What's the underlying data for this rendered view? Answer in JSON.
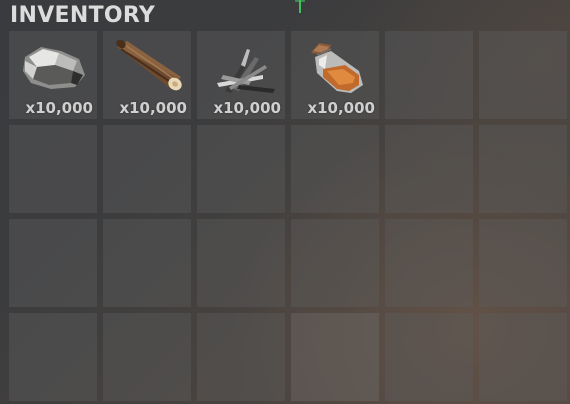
{
  "inventory": {
    "title": "INVENTORY",
    "columns": 6,
    "rows": 4,
    "items": [
      {
        "name": "Stone",
        "icon": "stone-icon",
        "quantity": "x10,000"
      },
      {
        "name": "Wood",
        "icon": "wood-log-icon",
        "quantity": "x10,000"
      },
      {
        "name": "Metal Fragments",
        "icon": "metal-fragments-icon",
        "quantity": "x10,000"
      },
      {
        "name": "Gun Powder Jar",
        "icon": "jar-icon",
        "quantity": "x10,000"
      }
    ]
  },
  "colors": {
    "title": "#dcdcdc",
    "quantity": "#cfcfcf",
    "slot": "#5c5c5c",
    "marker": "#3fbf5f"
  }
}
